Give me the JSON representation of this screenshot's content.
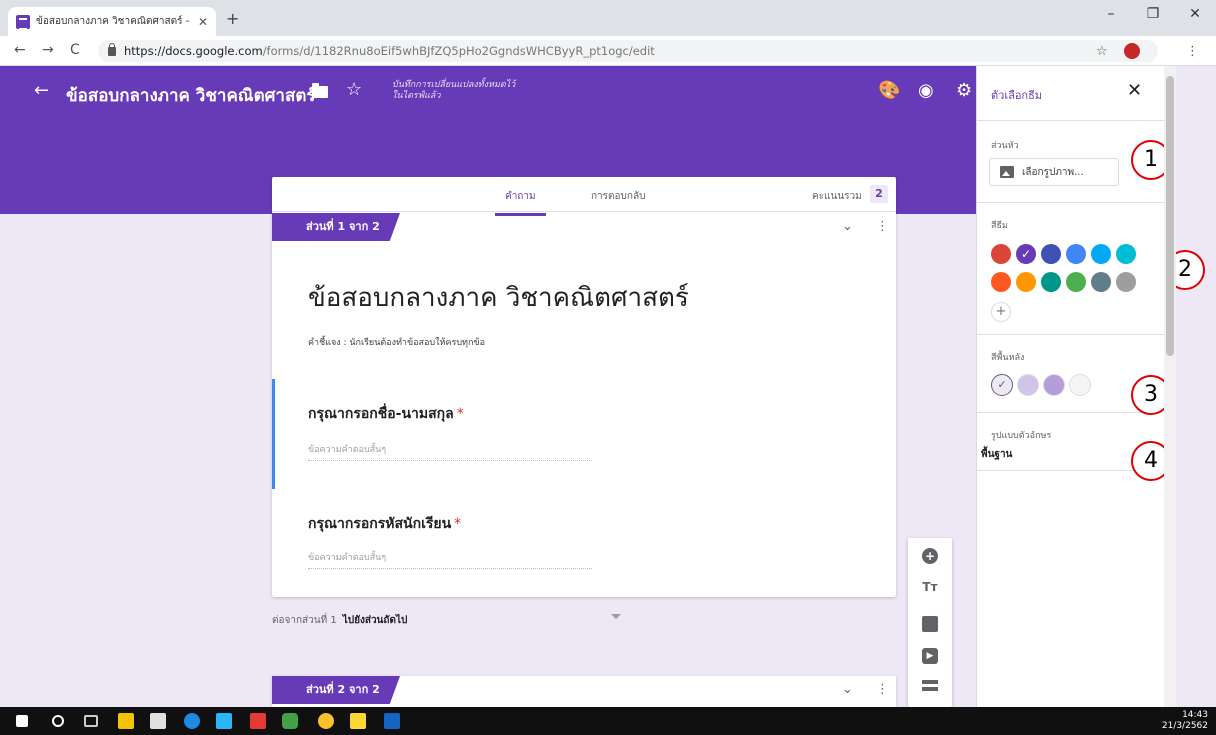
{
  "browser": {
    "tab_title": "ข้อสอบกลางภาค วิชาคณิตศาสตร์ - G",
    "url_domain": "https://docs.google.com",
    "url_path": "/forms/d/1182Rnu8oEif5whBJfZQ5pHo2GgndsWHCByyR_pt1ogc/edit"
  },
  "header": {
    "title": "ข้อสอบกลางภาค วิชาคณิตศาสตร์",
    "save_status": "บันทึกการเปลี่ยนแปลงทั้งหมดไว้\nในไดรฟ์แล้ว"
  },
  "form": {
    "tabs": {
      "questions": "คำถาม",
      "responses": "การตอบกลับ"
    },
    "total_points_label": "คะแนนรวม",
    "total_points": "2",
    "section1_label": "ส่วนที่ 1 จาก 2",
    "section2_label": "ส่วนที่ 2 จาก 2",
    "title": "ข้อสอบกลางภาค วิชาคณิตศาสตร์",
    "description": "คำชี้แจง : นักเรียนต้องทำข้อสอบให้ครบทุกข้อ",
    "questions": [
      {
        "title": "กรุณากรอกชื่อ-นามสกุล",
        "placeholder": "ข้อความคำตอบสั้นๆ"
      },
      {
        "title": "กรุณากรอกรหัสนักเรียน",
        "placeholder": "ข้อความคำตอบสั้นๆ"
      }
    ],
    "required_mark": "*",
    "after_section_label": "ต่อจากส่วนที่ 1",
    "after_section_value": "ไปยังส่วนถัดไป"
  },
  "theme_panel": {
    "title": "ตัวเลือกธีม",
    "header_label": "ส่วนหัว",
    "choose_image": "เลือกรูปภาพ...",
    "theme_color_label": "สีธีม",
    "theme_colors": [
      "#db4437",
      "#673ab7",
      "#3f51b5",
      "#4285f4",
      "#03a9f4",
      "#00bcd4",
      "#ff5722",
      "#ff9800",
      "#009688",
      "#4caf50",
      "#607d8b",
      "#9e9e9e"
    ],
    "background_label": "สีพื้นหลัง",
    "background_colors": [
      "#ede7f6",
      "#d1c4e9",
      "#b39ddb",
      "#f5f5f5"
    ],
    "font_style_label": "รูปแบบตัวอักษร",
    "font_style_value": "พื้นฐาน"
  },
  "callouts": [
    "1",
    "2",
    "3",
    "4"
  ],
  "taskbar": {
    "time": "14:43",
    "date": "21/3/2562"
  }
}
